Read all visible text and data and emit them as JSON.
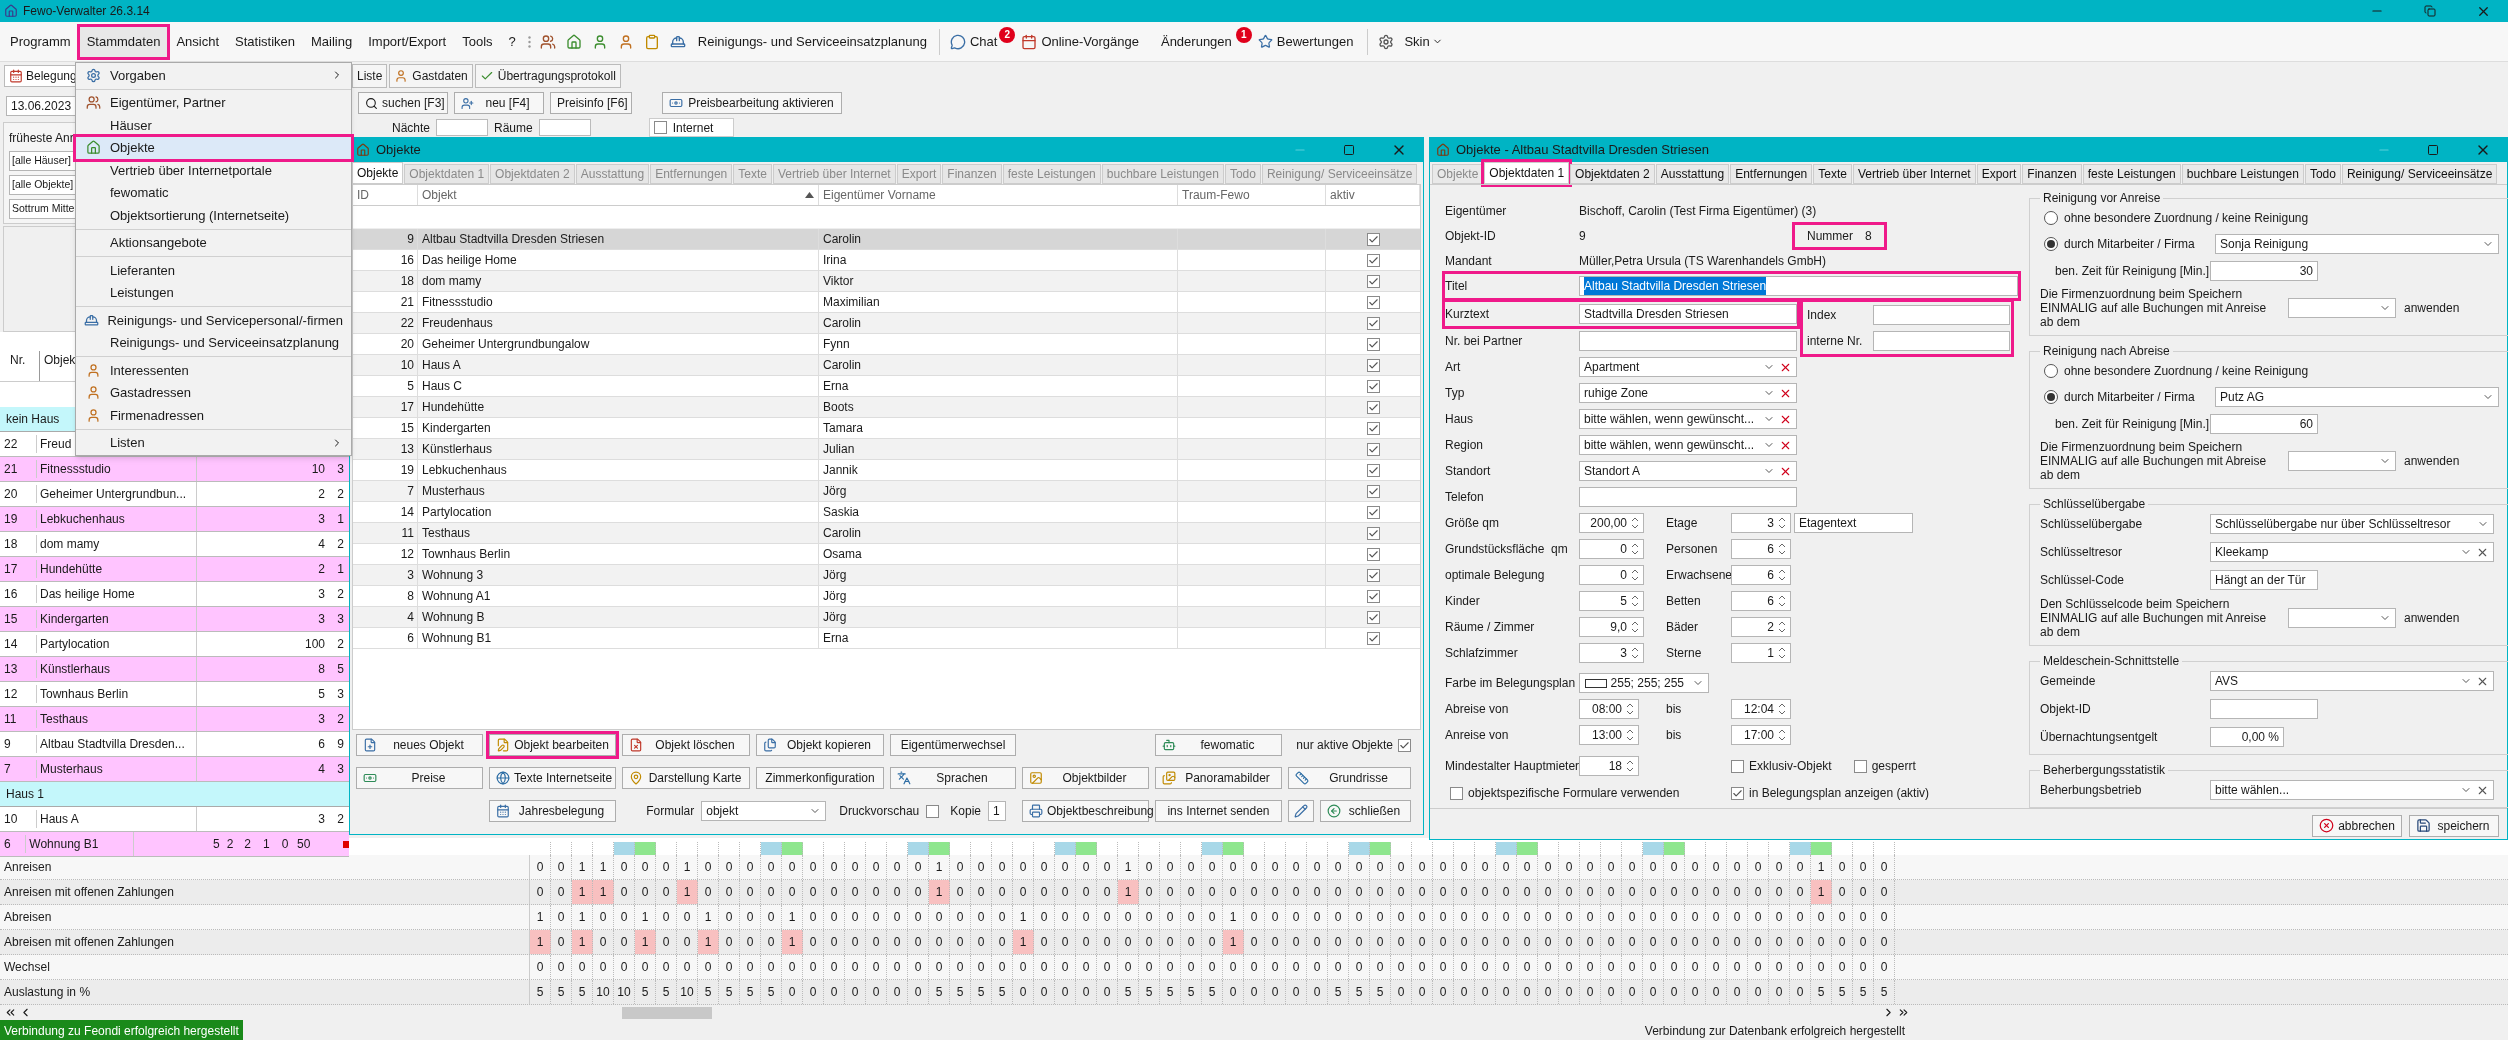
{
  "app": {
    "title": "Fewo-Verwalter 26.3.14"
  },
  "menubar": [
    {
      "label": "Programm",
      "marked": false
    },
    {
      "label": "Stammdaten",
      "marked": true
    },
    {
      "label": "Ansicht",
      "marked": false
    },
    {
      "label": "Statistiken",
      "marked": false
    },
    {
      "label": "Mailing",
      "marked": false
    },
    {
      "label": "Import/Export",
      "marked": false
    },
    {
      "label": "Tools",
      "marked": false
    },
    {
      "label": "?",
      "marked": false
    }
  ],
  "toolbar": {
    "planning": "Reinigungs- und Serviceeinsatzplanung",
    "chat": {
      "label": "Chat",
      "badge": "2"
    },
    "online": "Online-Vorgänge",
    "changes": {
      "label": "Änderungen",
      "badge": "1"
    },
    "reviews": "Bewertungen",
    "skin": "Skin"
  },
  "menu": {
    "groups": [
      [
        {
          "label": "Vorgaben",
          "kind": "settings",
          "submenu": true,
          "selected": false,
          "marked": false
        }
      ],
      [
        {
          "label": "Eigentümer, Partner",
          "kind": "owners",
          "submenu": false,
          "selected": false,
          "marked": false
        },
        {
          "label": "Häuser",
          "kind": "plain",
          "submenu": false,
          "selected": false,
          "marked": false
        },
        {
          "label": "Objekte",
          "kind": "house",
          "submenu": false,
          "selected": true,
          "marked": true
        },
        {
          "label": "Vertrieb über Internetportale",
          "kind": "plain",
          "submenu": false,
          "selected": false,
          "marked": false
        },
        {
          "label": "fewomatic",
          "kind": "plain",
          "submenu": false,
          "selected": false,
          "marked": false
        },
        {
          "label": "Objektsortierung (Internetseite)",
          "kind": "plain",
          "submenu": false,
          "selected": false,
          "marked": false
        }
      ],
      [
        {
          "label": "Aktionsangebote",
          "kind": "plain",
          "submenu": false,
          "selected": false,
          "marked": false
        }
      ],
      [
        {
          "label": "Lieferanten",
          "kind": "plain",
          "submenu": false,
          "selected": false,
          "marked": false
        },
        {
          "label": "Leistungen",
          "kind": "plain",
          "submenu": false,
          "selected": false,
          "marked": false
        }
      ],
      [
        {
          "label": "Reinigungs- und Servicepersonal/-firmen",
          "kind": "worker",
          "submenu": false,
          "selected": false,
          "marked": false
        },
        {
          "label": "Reinigungs- und Serviceeinsatzplanung",
          "kind": "plain",
          "submenu": false,
          "selected": false,
          "marked": false
        }
      ],
      [
        {
          "label": "Interessenten",
          "kind": "person",
          "submenu": false,
          "selected": false,
          "marked": false
        },
        {
          "label": "Gastadressen",
          "kind": "person",
          "submenu": false,
          "selected": false,
          "marked": false
        },
        {
          "label": "Firmenadressen",
          "kind": "person",
          "submenu": false,
          "selected": false,
          "marked": false
        }
      ],
      [
        {
          "label": "Listen",
          "kind": "plain",
          "submenu": true,
          "selected": false,
          "marked": false
        }
      ]
    ]
  },
  "left": {
    "tab": "Belegung",
    "date": "13.06.2023",
    "filter_label": "früheste Anr",
    "filters": [
      "[alle Häuser]",
      "[alle Objekte]",
      "Sottrum Mitte"
    ],
    "columns": [
      "Nr.",
      "Objek"
    ],
    "groups": [
      {
        "name": "kein Haus",
        "rows": [
          {
            "nr": "22",
            "name": "Freud",
            "values": [],
            "highlighted": false
          },
          {
            "nr": "21",
            "name": "Fitnessstudio",
            "values": [
              "10",
              "3"
            ],
            "highlighted": true
          },
          {
            "nr": "20",
            "name": "Geheimer Untergrundbun...",
            "values": [
              "2",
              "2"
            ],
            "highlighted": false
          },
          {
            "nr": "19",
            "name": "Lebkuchenhaus",
            "values": [
              "3",
              "1"
            ],
            "highlighted": true
          },
          {
            "nr": "18",
            "name": "dom mamy",
            "values": [
              "4",
              "2"
            ],
            "highlighted": false
          },
          {
            "nr": "17",
            "name": "Hundehütte",
            "values": [
              "2",
              "1"
            ],
            "highlighted": true
          },
          {
            "nr": "16",
            "name": "Das heilige Home",
            "values": [
              "3",
              "2"
            ],
            "highlighted": false
          },
          {
            "nr": "15",
            "name": "Kindergarten",
            "values": [
              "3",
              "3"
            ],
            "highlighted": true
          },
          {
            "nr": "14",
            "name": "Partylocation",
            "values": [
              "100",
              "2"
            ],
            "highlighted": false
          },
          {
            "nr": "13",
            "name": "Künstlerhaus",
            "values": [
              "8",
              "5"
            ],
            "highlighted": true
          },
          {
            "nr": "12",
            "name": "Townhaus Berlin",
            "values": [
              "5",
              "3"
            ],
            "highlighted": false
          },
          {
            "nr": "11",
            "name": "Testhaus",
            "values": [
              "3",
              "2"
            ],
            "highlighted": true
          },
          {
            "nr": "9",
            "name": "Altbau Stadtvilla Dresden...",
            "values": [
              "6",
              "9"
            ],
            "highlighted": false
          },
          {
            "nr": "7",
            "name": "Musterhaus",
            "values": [
              "4",
              "3"
            ],
            "highlighted": true
          }
        ]
      },
      {
        "name": "Haus 1",
        "rows": [
          {
            "nr": "10",
            "name": "Haus A",
            "values": [
              "3",
              "2"
            ],
            "highlighted": false
          },
          {
            "nr": "6",
            "name": "Wohnung B1",
            "values": [
              "5",
              "2"
            ],
            "highlighted": true,
            "extra": [
              "2",
              "1",
              "0",
              "50"
            ]
          }
        ]
      }
    ]
  },
  "background": {
    "tabs": [
      "Liste",
      "Gastdaten",
      "Übertragungsprotokoll"
    ],
    "buttons": [
      "suchen [F3]",
      "neu [F4]",
      "Preisinfo [F6]",
      "Preisbearbeitung aktivieren"
    ],
    "filters": [
      "Nächte",
      "Räume"
    ],
    "internet": {
      "label": "Internet",
      "checked": false
    }
  },
  "objects_window": {
    "title": "Objekte",
    "tabs": [
      {
        "label": "Objekte",
        "selected": true,
        "disabled": false
      },
      {
        "label": "Objektdaten 1",
        "selected": false,
        "disabled": true
      },
      {
        "label": "Objektdaten 2",
        "selected": false,
        "disabled": true
      },
      {
        "label": "Ausstattung",
        "selected": false,
        "disabled": true
      },
      {
        "label": "Entfernungen",
        "selected": false,
        "disabled": true
      },
      {
        "label": "Texte",
        "selected": false,
        "disabled": true
      },
      {
        "label": "Vertrieb über Internet",
        "selected": false,
        "disabled": true
      },
      {
        "label": "Export",
        "selected": false,
        "disabled": true
      },
      {
        "label": "Finanzen",
        "selected": false,
        "disabled": true
      },
      {
        "label": "feste Leistungen",
        "selected": false,
        "disabled": true
      },
      {
        "label": "buchbare Leistungen",
        "selected": false,
        "disabled": true
      },
      {
        "label": "Todo",
        "selected": false,
        "disabled": true
      },
      {
        "label": "Reinigung/ Serviceeinsätze",
        "selected": false,
        "disabled": true
      }
    ],
    "columns": [
      {
        "label": "ID",
        "sorted": false
      },
      {
        "label": "Objekt",
        "sorted": true
      },
      {
        "label": "Eigentümer Vorname",
        "sorted": false
      },
      {
        "label": "Traum-Fewo",
        "sorted": false
      },
      {
        "label": "aktiv",
        "sorted": false
      }
    ],
    "rows": [
      {
        "id": "9",
        "name": "Altbau Stadtvilla Dresden Striesen",
        "owner": "Carolin",
        "active": true,
        "selected": true
      },
      {
        "id": "16",
        "name": "Das heilige Home",
        "owner": "Irina",
        "active": true,
        "selected": false
      },
      {
        "id": "18",
        "name": "dom mamy",
        "owner": "Viktor",
        "active": true,
        "selected": false
      },
      {
        "id": "21",
        "name": "Fitnessstudio",
        "owner": "Maximilian",
        "active": true,
        "selected": false
      },
      {
        "id": "22",
        "name": "Freudenhaus",
        "owner": "Carolin",
        "active": true,
        "selected": false
      },
      {
        "id": "20",
        "name": "Geheimer Untergrundbungalow",
        "owner": "Fynn",
        "active": true,
        "selected": false
      },
      {
        "id": "10",
        "name": "Haus A",
        "owner": "Carolin",
        "active": true,
        "selected": false
      },
      {
        "id": "5",
        "name": "Haus C",
        "owner": "Erna",
        "active": true,
        "selected": false
      },
      {
        "id": "17",
        "name": "Hundehütte",
        "owner": "Boots",
        "active": true,
        "selected": false
      },
      {
        "id": "15",
        "name": "Kindergarten",
        "owner": "Tamara",
        "active": true,
        "selected": false
      },
      {
        "id": "13",
        "name": "Künstlerhaus",
        "owner": "Julian",
        "active": true,
        "selected": false
      },
      {
        "id": "19",
        "name": "Lebkuchenhaus",
        "owner": "Jannik",
        "active": true,
        "selected": false
      },
      {
        "id": "7",
        "name": "Musterhaus",
        "owner": "Jörg",
        "active": true,
        "selected": false
      },
      {
        "id": "14",
        "name": "Partylocation",
        "owner": "Saskia",
        "active": true,
        "selected": false
      },
      {
        "id": "11",
        "name": "Testhaus",
        "owner": "Carolin",
        "active": true,
        "selected": false
      },
      {
        "id": "12",
        "name": "Townhaus Berlin",
        "owner": "Osama",
        "active": true,
        "selected": false
      },
      {
        "id": "3",
        "name": "Wohnung 3",
        "owner": "Jörg",
        "active": true,
        "selected": false
      },
      {
        "id": "8",
        "name": "Wohnung A1",
        "owner": "Jörg",
        "active": true,
        "selected": false
      },
      {
        "id": "4",
        "name": "Wohnung B",
        "owner": "Jörg",
        "active": true,
        "selected": false
      },
      {
        "id": "6",
        "name": "Wohnung B1",
        "owner": "Erna",
        "active": true,
        "selected": false
      }
    ],
    "actions_1": [
      {
        "label": "neues Objekt",
        "marked": false
      },
      {
        "label": "Objekt bearbeiten",
        "marked": true
      },
      {
        "label": "Objekt löschen",
        "marked": false
      },
      {
        "label": "Objekt kopieren",
        "marked": false
      },
      {
        "label": "Eigentümerwechsel",
        "marked": false
      }
    ],
    "fewomatic": "fewomatic",
    "only_active": {
      "label": "nur aktive Objekte",
      "checked": true
    },
    "actions_2": [
      "Preise",
      "Texte Internetseite",
      "Darstellung Karte",
      "Zimmerkonfiguration",
      "Sprachen",
      "Objektbilder",
      "Panoramabilder",
      "Grundrisse"
    ],
    "jahresbelegung": "Jahresbelegung",
    "formular": {
      "label": "Formular",
      "value": "objekt"
    },
    "druckvorschau": {
      "label": "Druckvorschau",
      "checked": false
    },
    "kopie": {
      "label": "Kopie",
      "value": "1"
    },
    "actions_3": [
      "Objektbeschreibung",
      "ins Internet senden"
    ],
    "close": "schließen"
  },
  "form_window": {
    "title": "Objekte - Altbau Stadtvilla Dresden Striesen",
    "tabs": [
      {
        "label": "Objekte",
        "selected": false,
        "disabled": true,
        "marked": false
      },
      {
        "label": "Objektdaten 1",
        "selected": true,
        "disabled": false,
        "marked": true
      },
      {
        "label": "Objektdaten 2",
        "selected": false,
        "disabled": false,
        "marked": false
      },
      {
        "label": "Ausstattung",
        "selected": false,
        "disabled": false,
        "marked": false
      },
      {
        "label": "Entfernungen",
        "selected": false,
        "disabled": false,
        "marked": false
      },
      {
        "label": "Texte",
        "selected": false,
        "disabled": false,
        "marked": false
      },
      {
        "label": "Vertrieb über Internet",
        "selected": false,
        "disabled": false,
        "marked": false
      },
      {
        "label": "Export",
        "selected": false,
        "disabled": false,
        "marked": false
      },
      {
        "label": "Finanzen",
        "selected": false,
        "disabled": false,
        "marked": false
      },
      {
        "label": "feste Leistungen",
        "selected": false,
        "disabled": false,
        "marked": false
      },
      {
        "label": "buchbare Leistungen",
        "selected": false,
        "disabled": false,
        "marked": false
      },
      {
        "label": "Todo",
        "selected": false,
        "disabled": false,
        "marked": false
      },
      {
        "label": "Reinigung/ Serviceeinsätze",
        "selected": false,
        "disabled": false,
        "marked": false
      }
    ],
    "info": [
      {
        "label": "Eigentümer",
        "value": "Bischoff, Carolin (Test Firma Eigentümer) (3)"
      },
      {
        "label": "Objekt-ID",
        "value": "9"
      },
      {
        "label": "Mandant",
        "value": "Müller,Petra Ursula (TS Warenhandels GmbH)"
      }
    ],
    "nummer": {
      "label": "Nummer",
      "value": "8",
      "marked": true
    },
    "titel": {
      "label": "Titel",
      "value": "Altbau Stadtvilla Dresden Striesen",
      "selected": true,
      "marked": true
    },
    "kurztext": {
      "label": "Kurztext",
      "value": "Stadtvilla Dresden Striesen",
      "marked": true
    },
    "partner": {
      "label": "Nr. bei Partner"
    },
    "index_box": {
      "marked": true,
      "fields": [
        {
          "label": "Index"
        },
        {
          "label": "interne Nr."
        }
      ]
    },
    "combos": [
      {
        "label": "Art",
        "value": "Apartment"
      },
      {
        "label": "Typ",
        "value": "ruhige Zone"
      },
      {
        "label": "Haus",
        "value": "bitte wählen, wenn gewünscht..."
      },
      {
        "label": "Region",
        "value": "bitte wählen, wenn gewünscht..."
      },
      {
        "label": "Standort",
        "value": "Standort A"
      }
    ],
    "telefon": {
      "label": "Telefon"
    },
    "spins": [
      {
        "left": {
          "label": "Größe qm",
          "value": "200,00"
        },
        "right": {
          "label": "Etage",
          "value": "3"
        },
        "extra": "Etagentext"
      },
      {
        "left": {
          "label": "Grundstücksfläche  qm",
          "value": "0"
        },
        "right": {
          "label": "Personen",
          "value": "6"
        }
      },
      {
        "left": {
          "label": "optimale Belegung",
          "value": "0"
        },
        "right": {
          "label": "Erwachsene",
          "value": "6"
        }
      },
      {
        "left": {
          "label": "Kinder",
          "value": "5"
        },
        "right": {
          "label": "Betten",
          "value": "6"
        }
      },
      {
        "left": {
          "label": "Räume / Zimmer",
          "value": "9,0"
        },
        "right": {
          "label": "Bäder",
          "value": "2"
        }
      },
      {
        "left": {
          "label": "Schlafzimmer",
          "value": "3"
        },
        "right": {
          "label": "Sterne",
          "value": "1"
        }
      }
    ],
    "color": {
      "label": "Farbe im Belegungsplan",
      "value": "255; 255; 255",
      "color": "#ffffff"
    },
    "times": [
      {
        "label": "Abreise von",
        "from": "08:00",
        "to_label": "bis",
        "to": "12:04"
      },
      {
        "label": "Anreise von",
        "from": "13:00",
        "to_label": "bis",
        "to": "17:00"
      }
    ],
    "min_age": {
      "label": "Mindestalter Hauptmieter",
      "value": "18"
    },
    "checks": [
      {
        "label": "Exklusiv-Objekt",
        "checked": false
      },
      {
        "label": "gesperrt",
        "checked": false
      }
    ],
    "formulare": {
      "label": "objektspezifische Formulare verwenden",
      "checked": false
    },
    "plan": {
      "label": "in Belegungsplan anzeigen (aktiv)",
      "checked": true
    },
    "cleaning": [
      {
        "title": "Reinigung vor Anreise",
        "options": [
          {
            "label": "ohne besondere Zuordnung / keine Reinigung",
            "selected": false
          },
          {
            "label": "durch Mitarbeiter / Firma",
            "selected": true
          }
        ],
        "company": "Sonja Reinigung",
        "time_label": "ben. Zeit für Reinigung [Min.]",
        "time": "30",
        "apply_text": "Die Firmenzuordnung beim Speichern EINMALIG auf alle Buchungen mit Anreise ab dem",
        "apply": "anwenden"
      },
      {
        "title": "Reinigung nach Abreise",
        "options": [
          {
            "label": "ohne besondere Zuordnung / keine Reinigung",
            "selected": false
          },
          {
            "label": "durch Mitarbeiter / Firma",
            "selected": true
          }
        ],
        "company": "Putz AG",
        "time_label": "ben. Zeit für Reinigung [Min.]",
        "time": "60",
        "apply_text": "Die Firmenzuordnung beim Speichern EINMALIG auf alle Buchungen mit Abreise ab dem",
        "apply": "anwenden"
      }
    ],
    "groups": [
      {
        "title": "Schlüsselübergabe",
        "rows": [
          {
            "label": "Schlüsselübergabe",
            "value": "Schlüsselübergabe nur über Schlüsseltresor",
            "kind": "select"
          },
          {
            "label": "Schlüsseltresor",
            "value": "Kleekamp",
            "kind": "clearable"
          },
          {
            "label": "Schlüssel-Code",
            "value": "Hängt an der Tür",
            "kind": "text"
          }
        ],
        "apply_text": "Den Schlüsselcode beim Speichern EINMALIG auf alle Buchungen mit Anreise ab dem",
        "apply": "anwenden"
      },
      {
        "title": "Meldeschein-Schnittstelle",
        "rows": [
          {
            "label": "Gemeinde",
            "value": "AVS",
            "kind": "clearable"
          },
          {
            "label": "Objekt-ID",
            "kind": "text"
          },
          {
            "label": "Übernachtungsentgelt",
            "value": "0,00 %",
            "kind": "number"
          }
        ]
      },
      {
        "title": "Beherbergungsstatistik",
        "rows": [
          {
            "label": "Beherbungsbetrieb",
            "value": "bitte wählen...",
            "kind": "clearable"
          }
        ]
      }
    ],
    "footer": [
      {
        "label": "abbrechen",
        "kind": "cancel"
      },
      {
        "label": "speichern",
        "kind": "save"
      }
    ]
  },
  "stats": {
    "days": [
      {
        "kind": "wd"
      },
      {
        "kind": "wd"
      },
      {
        "kind": "wd"
      },
      {
        "kind": "wd"
      },
      {
        "kind": "sa"
      },
      {
        "kind": "so"
      },
      {
        "kind": "wd"
      },
      {
        "kind": "wd"
      },
      {
        "kind": "wd"
      },
      {
        "kind": "wd"
      },
      {
        "kind": "wd"
      },
      {
        "kind": "sa"
      },
      {
        "kind": "so"
      },
      {
        "kind": "wd"
      },
      {
        "kind": "wd"
      },
      {
        "kind": "wd"
      },
      {
        "kind": "wd"
      },
      {
        "kind": "wd"
      },
      {
        "kind": "sa"
      },
      {
        "kind": "so"
      },
      {
        "kind": "wd"
      },
      {
        "kind": "wd"
      },
      {
        "kind": "wd"
      },
      {
        "kind": "wd"
      },
      {
        "kind": "wd"
      },
      {
        "kind": "sa"
      },
      {
        "kind": "so"
      },
      {
        "kind": "wd"
      },
      {
        "kind": "wd"
      },
      {
        "kind": "wd"
      },
      {
        "kind": "wd"
      },
      {
        "kind": "wd"
      },
      {
        "kind": "sa"
      },
      {
        "kind": "so"
      },
      {
        "kind": "wd"
      },
      {
        "kind": "wd"
      },
      {
        "kind": "wd"
      },
      {
        "kind": "wd"
      },
      {
        "kind": "wd"
      },
      {
        "kind": "sa"
      },
      {
        "kind": "so"
      },
      {
        "kind": "wd"
      },
      {
        "kind": "wd"
      },
      {
        "kind": "wd"
      },
      {
        "kind": "wd"
      },
      {
        "kind": "wd"
      },
      {
        "kind": "sa"
      },
      {
        "kind": "so"
      },
      {
        "kind": "wd"
      },
      {
        "kind": "wd"
      },
      {
        "kind": "wd"
      },
      {
        "kind": "wd"
      },
      {
        "kind": "wd"
      },
      {
        "kind": "sa"
      },
      {
        "kind": "so"
      },
      {
        "kind": "wd"
      },
      {
        "kind": "wd"
      },
      {
        "kind": "wd"
      },
      {
        "kind": "wd"
      },
      {
        "kind": "wd"
      },
      {
        "kind": "sa"
      },
      {
        "kind": "so"
      },
      {
        "kind": "wd"
      },
      {
        "kind": "wd"
      },
      {
        "kind": "wd"
      }
    ],
    "rows": [
      {
        "label": "Anreisen",
        "kind": "count",
        "values": [
          "0",
          "0",
          "1",
          "1",
          "0",
          "0",
          "0",
          "1",
          "0",
          "0",
          "0",
          "0",
          "0",
          "0",
          "0",
          "0",
          "0",
          "0",
          "0",
          "1",
          "0",
          "0",
          "0",
          "0",
          "0",
          "0",
          "0",
          "0",
          "1",
          "0",
          "0",
          "0",
          "0",
          "0",
          "0",
          "0",
          "0",
          "0",
          "0",
          "0",
          "0",
          "0",
          "0",
          "0",
          "0",
          "0",
          "0",
          "0",
          "0",
          "0",
          "0",
          "0",
          "0",
          "0",
          "0",
          "0",
          "0",
          "0",
          "0",
          "0",
          "0",
          "1",
          "0",
          "0",
          "0"
        ]
      },
      {
        "label": "Anreisen mit offenen Zahlungen",
        "kind": "payment",
        "values": [
          "0",
          "0",
          "1",
          "1",
          "0",
          "0",
          "0",
          "1",
          "0",
          "0",
          "0",
          "0",
          "0",
          "0",
          "0",
          "0",
          "0",
          "0",
          "0",
          "1",
          "0",
          "0",
          "0",
          "0",
          "0",
          "0",
          "0",
          "0",
          "1",
          "0",
          "0",
          "0",
          "0",
          "0",
          "0",
          "0",
          "0",
          "0",
          "0",
          "0",
          "0",
          "0",
          "0",
          "0",
          "0",
          "0",
          "0",
          "0",
          "0",
          "0",
          "0",
          "0",
          "0",
          "0",
          "0",
          "0",
          "0",
          "0",
          "0",
          "0",
          "0",
          "1",
          "0",
          "0",
          "0"
        ]
      },
      {
        "label": "Abreisen",
        "kind": "count",
        "values": [
          "1",
          "0",
          "1",
          "0",
          "0",
          "1",
          "0",
          "0",
          "1",
          "0",
          "0",
          "0",
          "1",
          "0",
          "0",
          "0",
          "0",
          "0",
          "0",
          "0",
          "0",
          "0",
          "0",
          "1",
          "0",
          "0",
          "0",
          "0",
          "0",
          "0",
          "0",
          "0",
          "0",
          "1",
          "0",
          "0",
          "0",
          "0",
          "0",
          "0",
          "0",
          "0",
          "0",
          "0",
          "0",
          "0",
          "0",
          "0",
          "0",
          "0",
          "0",
          "0",
          "0",
          "0",
          "0",
          "0",
          "0",
          "0",
          "0",
          "0",
          "0",
          "0",
          "0",
          "0",
          "0"
        ]
      },
      {
        "label": "Abreisen mit offenen Zahlungen",
        "kind": "payment",
        "values": [
          "1",
          "0",
          "1",
          "0",
          "0",
          "1",
          "0",
          "0",
          "1",
          "0",
          "0",
          "0",
          "1",
          "0",
          "0",
          "0",
          "0",
          "0",
          "0",
          "0",
          "0",
          "0",
          "0",
          "1",
          "0",
          "0",
          "0",
          "0",
          "0",
          "0",
          "0",
          "0",
          "0",
          "1",
          "0",
          "0",
          "0",
          "0",
          "0",
          "0",
          "0",
          "0",
          "0",
          "0",
          "0",
          "0",
          "0",
          "0",
          "0",
          "0",
          "0",
          "0",
          "0",
          "0",
          "0",
          "0",
          "0",
          "0",
          "0",
          "0",
          "0",
          "0",
          "0",
          "0",
          "0"
        ]
      },
      {
        "label": "Wechsel",
        "kind": "count",
        "values": [
          "0",
          "0",
          "0",
          "0",
          "0",
          "0",
          "0",
          "0",
          "0",
          "0",
          "0",
          "0",
          "0",
          "0",
          "0",
          "0",
          "0",
          "0",
          "0",
          "0",
          "0",
          "0",
          "0",
          "0",
          "0",
          "0",
          "0",
          "0",
          "0",
          "0",
          "0",
          "0",
          "0",
          "0",
          "0",
          "0",
          "0",
          "0",
          "0",
          "0",
          "0",
          "0",
          "0",
          "0",
          "0",
          "0",
          "0",
          "0",
          "0",
          "0",
          "0",
          "0",
          "0",
          "0",
          "0",
          "0",
          "0",
          "0",
          "0",
          "0",
          "0",
          "0",
          "0",
          "0",
          "0"
        ]
      },
      {
        "label": "Auslastung in %",
        "kind": "count",
        "values": [
          "5",
          "5",
          "5",
          "10",
          "10",
          "5",
          "5",
          "10",
          "5",
          "5",
          "5",
          "5",
          "0",
          "0",
          "0",
          "0",
          "0",
          "0",
          "0",
          "5",
          "5",
          "5",
          "5",
          "0",
          "0",
          "0",
          "0",
          "0",
          "5",
          "5",
          "5",
          "5",
          "5",
          "0",
          "0",
          "0",
          "0",
          "0",
          "5",
          "5",
          "5",
          "0",
          "0",
          "0",
          "0",
          "0",
          "0",
          "0",
          "0",
          "0",
          "0",
          "0",
          "0",
          "0",
          "0",
          "0",
          "0",
          "0",
          "0",
          "0",
          "0",
          "5",
          "5",
          "5",
          "5"
        ]
      }
    ]
  },
  "status": {
    "left": "Verbindung zu Feondi erfolgreich hergestellt",
    "right": "Verbindung zur Datenbank erfolgreich hergestellt"
  }
}
